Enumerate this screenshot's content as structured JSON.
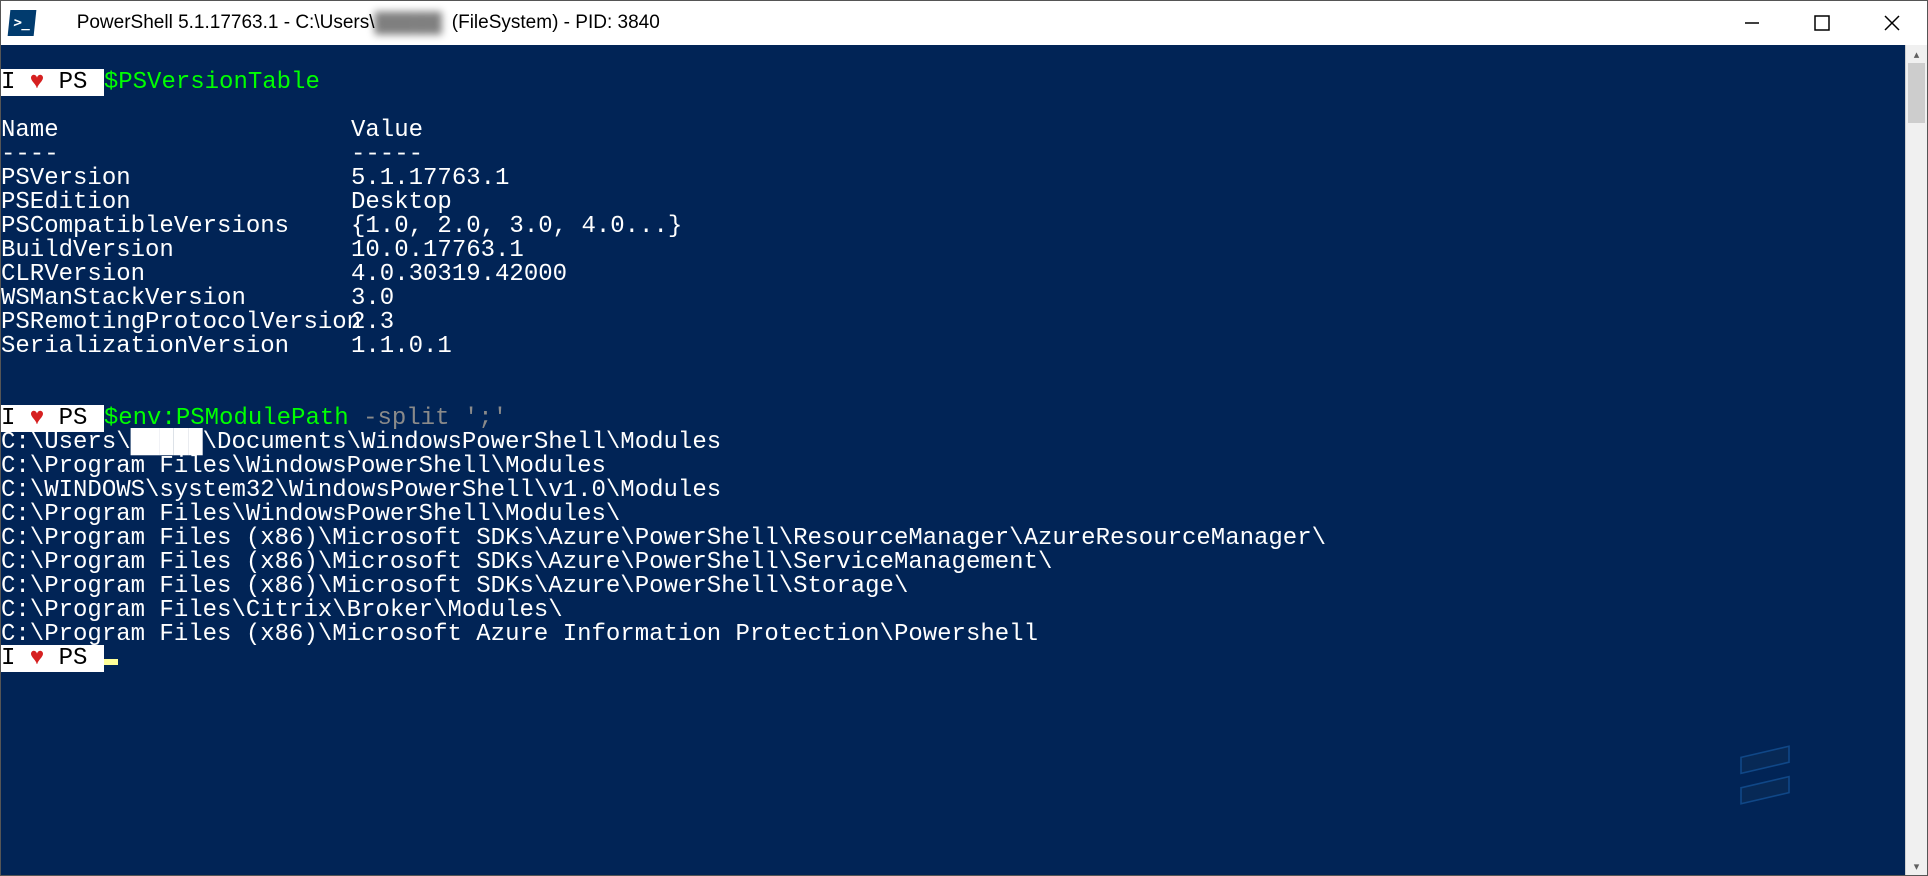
{
  "titlebar": {
    "prefix": "PowerShell 5.1.17763.1 - C:\\Users\\",
    "redacted": "█████",
    "suffix": " (FileSystem) - PID: 3840",
    "icon_label": ">_"
  },
  "prompt": {
    "p1": "I ",
    "heart": "♥",
    "p2": " PS "
  },
  "commands": {
    "cmd1": "$PSVersionTable",
    "cmd2_green": "$env:PSModulePath",
    "cmd2_gray": " -split ';'"
  },
  "table": {
    "headers": {
      "name": "Name",
      "value": "Value"
    },
    "separators": {
      "name": "----",
      "value": "-----"
    },
    "rows": [
      {
        "name": "PSVersion",
        "value": "5.1.17763.1"
      },
      {
        "name": "PSEdition",
        "value": "Desktop"
      },
      {
        "name": "PSCompatibleVersions",
        "value": "{1.0, 2.0, 3.0, 4.0...}"
      },
      {
        "name": "BuildVersion",
        "value": "10.0.17763.1"
      },
      {
        "name": "CLRVersion",
        "value": "4.0.30319.42000"
      },
      {
        "name": "WSManStackVersion",
        "value": "3.0"
      },
      {
        "name": "PSRemotingProtocolVersion",
        "value": "2.3"
      },
      {
        "name": "SerializationVersion",
        "value": "1.1.0.1"
      }
    ]
  },
  "module_paths": {
    "line0_prefix": "C:\\Users\\",
    "line0_suffix": "\\Documents\\WindowsPowerShell\\Modules",
    "lines": [
      "C:\\Program Files\\WindowsPowerShell\\Modules",
      "C:\\WINDOWS\\system32\\WindowsPowerShell\\v1.0\\Modules",
      "C:\\Program Files\\WindowsPowerShell\\Modules\\",
      "C:\\Program Files (x86)\\Microsoft SDKs\\Azure\\PowerShell\\ResourceManager\\AzureResourceManager\\",
      "C:\\Program Files (x86)\\Microsoft SDKs\\Azure\\PowerShell\\ServiceManagement\\",
      "C:\\Program Files (x86)\\Microsoft SDKs\\Azure\\PowerShell\\Storage\\",
      "C:\\Program Files\\Citrix\\Broker\\Modules\\",
      "C:\\Program Files (x86)\\Microsoft Azure Information Protection\\Powershell"
    ]
  }
}
